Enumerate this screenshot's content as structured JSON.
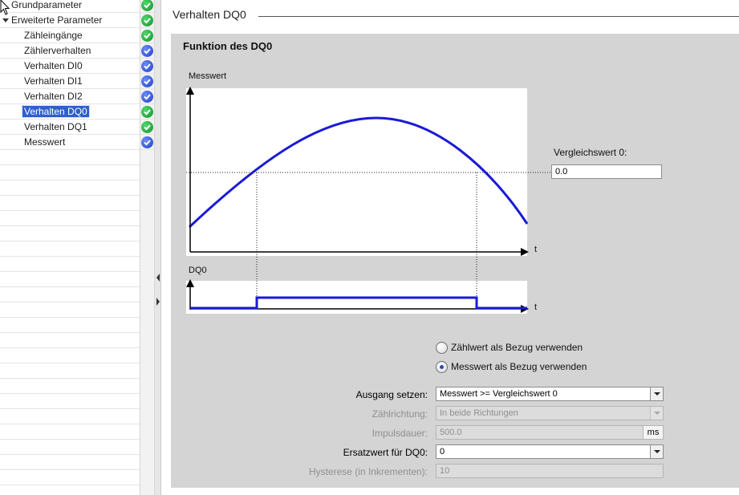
{
  "nav": {
    "items": [
      {
        "label": "Grundparameter",
        "status": "ok"
      },
      {
        "label": "Erweiterte Parameter",
        "status": "ok"
      },
      {
        "label": "Zähleingänge",
        "status": "ok"
      },
      {
        "label": "Zählerverhalten",
        "status": "info"
      },
      {
        "label": "Verhalten DI0",
        "status": "info"
      },
      {
        "label": "Verhalten DI1",
        "status": "info"
      },
      {
        "label": "Verhalten DI2",
        "status": "info"
      },
      {
        "label": "Verhalten DQ0",
        "status": "ok"
      },
      {
        "label": "Verhalten DQ1",
        "status": "ok"
      },
      {
        "label": "Messwert",
        "status": "info"
      }
    ],
    "selected": "Verhalten DQ0"
  },
  "section": {
    "title": "Verhalten DQ0"
  },
  "panel": {
    "title": "Funktion des DQ0",
    "graph": {
      "upper_label": "Messwert",
      "lower_label": "DQ0",
      "axis_t_upper": "t",
      "axis_t_lower": "t"
    },
    "compare": {
      "label": "Vergleichswert 0:",
      "value": "0.0"
    },
    "radios": [
      {
        "label": "Zählwert als Bezug verwenden",
        "checked": false
      },
      {
        "label": "Messwert als Bezug verwenden",
        "checked": true
      }
    ],
    "form": {
      "ausgang": {
        "label": "Ausgang setzen:",
        "value": "Messwert >= Vergleichswert 0"
      },
      "zaehlrichtung": {
        "label": "Zählrichtung:",
        "value": "In beide Richtungen"
      },
      "impulsdauer": {
        "label": "Impulsdauer:",
        "value": "500.0",
        "unit": "ms"
      },
      "ersatzwert": {
        "label": "Ersatzwert für DQ0:",
        "value": "0"
      },
      "hysterese": {
        "label": "Hysterese (in Inkrementen):",
        "value": "10"
      }
    }
  },
  "colors": {
    "curve": "#1a1ad6",
    "selected": "#2f5ed0",
    "ok": "#18a838",
    "info": "#2845d6"
  }
}
